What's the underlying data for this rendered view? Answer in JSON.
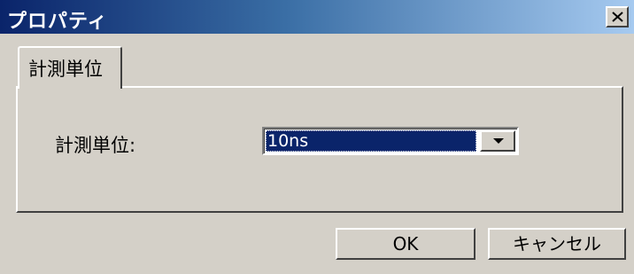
{
  "window": {
    "title": "プロパティ",
    "close_icon": "close-icon"
  },
  "tabs": [
    {
      "label": "計測単位",
      "selected": true
    }
  ],
  "form": {
    "unit_label": "計測単位:",
    "unit_value": "10ns",
    "unit_dropdown_icon": "chevron-down-icon"
  },
  "buttons": {
    "ok_label": "OK",
    "cancel_label": "キャンセル"
  },
  "colors": {
    "titlebar_start": "#0a246a",
    "titlebar_end": "#a6caf0",
    "face": "#d4d0c8",
    "selection": "#0a246a"
  }
}
